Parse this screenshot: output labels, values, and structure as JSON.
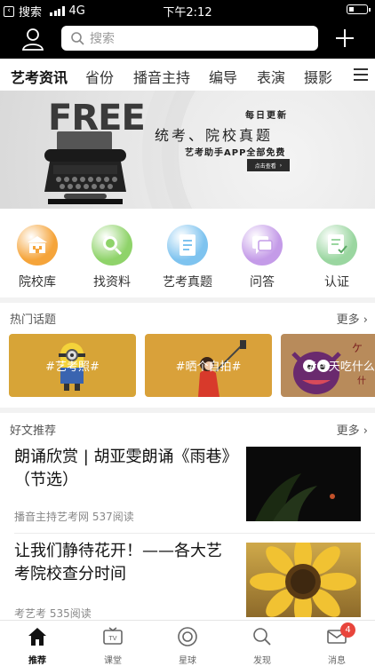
{
  "status_bar": {
    "back_label": "搜索",
    "network": "4G",
    "time": "下午2:12",
    "battery_level": 0.3
  },
  "header": {
    "search_placeholder": "搜索"
  },
  "tabs": [
    "艺考资讯",
    "省份",
    "播音主持",
    "编导",
    "表演",
    "摄影"
  ],
  "banner": {
    "free_text": "FREE",
    "daily": "每日更新",
    "headline": "统考、院校真题",
    "free_note": "艺考助手APP全部免费",
    "cta": "点击查看"
  },
  "shortcuts": [
    {
      "label": "院校库",
      "icon": "school-icon",
      "color": "#f5a43a"
    },
    {
      "label": "找资料",
      "icon": "magnifier-icon",
      "color": "#8fd36a"
    },
    {
      "label": "艺考真题",
      "icon": "document-icon",
      "color": "#7ec3ef"
    },
    {
      "label": "问答",
      "icon": "chat-icon",
      "color": "#c49be8"
    },
    {
      "label": "认证",
      "icon": "certificate-icon",
      "color": "#9ad6a0"
    }
  ],
  "hot_topics": {
    "title": "热门话题",
    "more": "更多",
    "items": [
      "#艺考照#",
      "#晒个自拍#",
      "#今天吃什么#"
    ]
  },
  "articles": {
    "title": "好文推荐",
    "more": "更多",
    "items": [
      {
        "title": "朗诵欣赏 | 胡亚雯朗诵《雨巷》（节选）",
        "meta": "播音主持艺考网 537阅读"
      },
      {
        "title": "让我们静待花开！——各大艺考院校查分时间",
        "meta": "考艺考 535阅读"
      }
    ]
  },
  "bottom_nav": {
    "items": [
      "推荐",
      "课堂",
      "星球",
      "发现",
      "消息"
    ],
    "badge": "4"
  }
}
